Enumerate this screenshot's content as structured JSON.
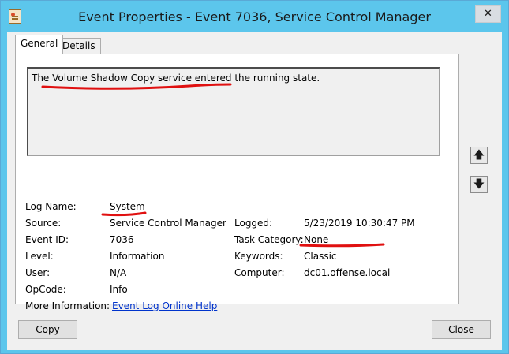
{
  "window": {
    "title": "Event Properties - Event 7036, Service Control Manager",
    "close_glyph": "✕"
  },
  "tabs": [
    {
      "label": "General"
    },
    {
      "label": "Details"
    }
  ],
  "event": {
    "description": "The Volume Shadow Copy service entered the running state.",
    "fields": {
      "log_name": {
        "label": "Log Name:",
        "value": "System"
      },
      "source": {
        "label": "Source:",
        "value": "Service Control Manager"
      },
      "event_id": {
        "label": "Event ID:",
        "value": "7036"
      },
      "level": {
        "label": "Level:",
        "value": "Information"
      },
      "user": {
        "label": "User:",
        "value": "N/A"
      },
      "opcode": {
        "label": "OpCode:",
        "value": "Info"
      },
      "more_info": {
        "label": "More Information:",
        "value": "Event Log Online Help"
      },
      "logged": {
        "label": "Logged:",
        "value": "5/23/2019 10:30:47 PM"
      },
      "task_category": {
        "label": "Task Category:",
        "value": "None"
      },
      "keywords": {
        "label": "Keywords:",
        "value": "Classic"
      },
      "computer": {
        "label": "Computer:",
        "value": "dc01.offense.local"
      }
    }
  },
  "side_buttons": {
    "up_glyph": "🡅",
    "down_glyph": "🡇"
  },
  "buttons": {
    "copy": "Copy",
    "close": "Close"
  },
  "colors": {
    "titlebar": "#5cc6ec",
    "annotation": "#e01010",
    "link": "#0033cc"
  }
}
